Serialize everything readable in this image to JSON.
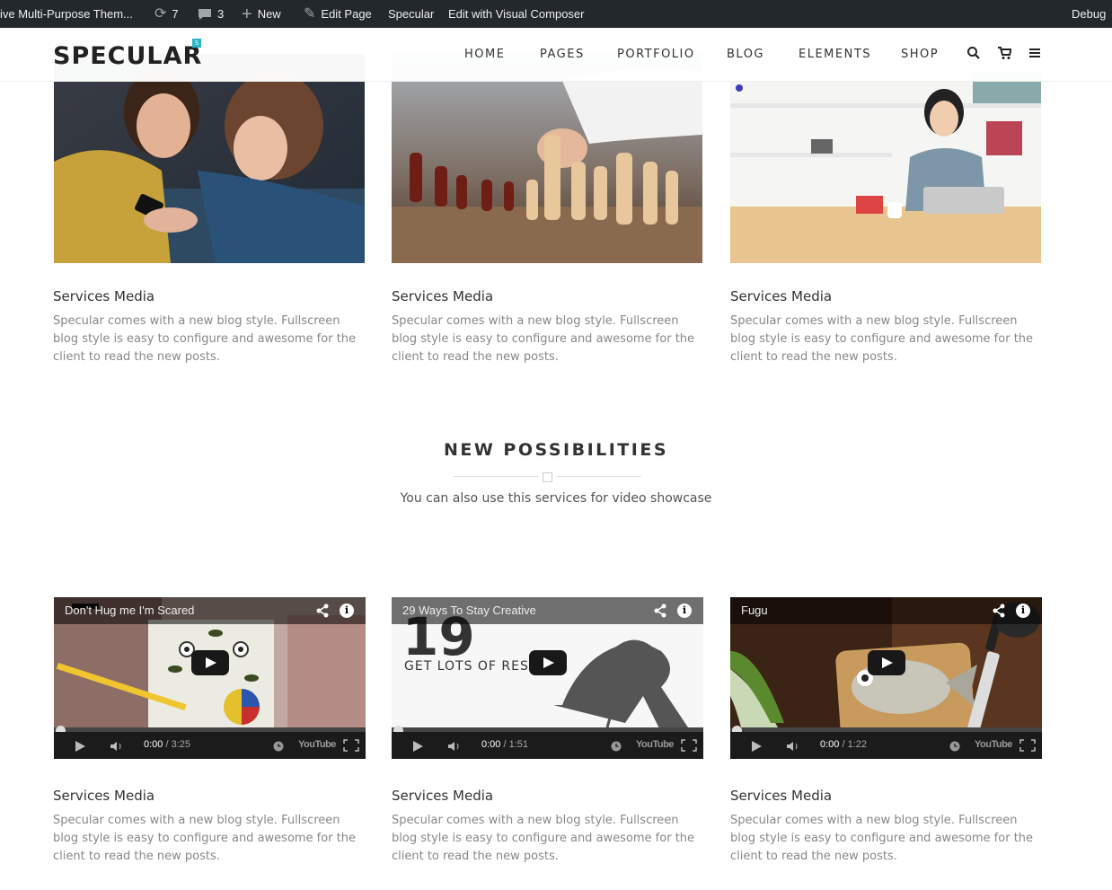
{
  "admin_bar": {
    "site_name": "ive Multi-Purpose Them...",
    "updates_count": "7",
    "comments_count": "3",
    "new_label": "New",
    "edit_page_label": "Edit Page",
    "specular_label": "Specular",
    "visual_composer_label": "Edit with Visual Composer",
    "debug_label": "Debug"
  },
  "header": {
    "logo": "SPECULAR",
    "logo_badge": "S",
    "nav": [
      "HOME",
      "PAGES",
      "PORTFOLIO",
      "BLOG",
      "ELEMENTS",
      "SHOP"
    ]
  },
  "top_cards": [
    {
      "title": "Services Media",
      "text": "Specular comes with a new blog style. Fullscreen blog style is easy to configure and awesome for the client to read the new posts."
    },
    {
      "title": "Services Media",
      "text": "Specular comes with a new blog style. Fullscreen blog style is easy to configure and awesome for the client to read the new posts."
    },
    {
      "title": "Services Media",
      "text": "Specular comes with a new blog style. Fullscreen blog style is easy to configure and awesome for the client to read the new posts."
    }
  ],
  "section": {
    "title": "NEW POSSIBILITIES",
    "subtitle": "You can also use this services for video showcase"
  },
  "videos": [
    {
      "title": "Don't Hug me I'm Scared",
      "current": "0:00",
      "duration": " / 3:25",
      "card_title": "Services Media",
      "card_text": "Specular comes with a new blog style. Fullscreen blog style is easy to configure and awesome for the client to read the new posts."
    },
    {
      "title": "29 Ways To Stay Creative",
      "current": "0:00",
      "duration": " / 1:51",
      "thumb_number": "19",
      "thumb_text": "GET LOTS OF RES",
      "card_title": "Services Media",
      "card_text": "Specular comes with a new blog style. Fullscreen blog style is easy to configure and awesome for the client to read the new posts."
    },
    {
      "title": "Fugu",
      "current": "0:00",
      "duration": " / 1:22",
      "card_title": "Services Media",
      "card_text": "Specular comes with a new blog style. Fullscreen blog style is easy to configure and awesome for the client to read the new posts."
    }
  ],
  "youtube_label": "YouTube"
}
